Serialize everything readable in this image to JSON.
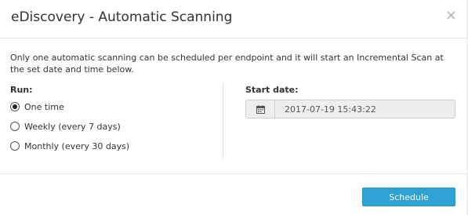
{
  "dialog": {
    "title": "eDiscovery - Automatic Scanning",
    "close_glyph": "×",
    "description": "Only one automatic scanning can be scheduled per endpoint and it will start an Incremental Scan at the set date and time below."
  },
  "run": {
    "label": "Run:",
    "options": [
      {
        "label": "One time",
        "checked": true
      },
      {
        "label": "Weekly (every 7 days)",
        "checked": false
      },
      {
        "label": "Monthly (every 30 days)",
        "checked": false
      }
    ]
  },
  "start": {
    "label": "Start date:",
    "value": "2017-07-19 15:43:22",
    "icon": "calendar-icon"
  },
  "footer": {
    "schedule_label": "Schedule"
  },
  "colors": {
    "primary_button": "#2ea3d6",
    "disabled_input_bg": "#eeeeee"
  }
}
